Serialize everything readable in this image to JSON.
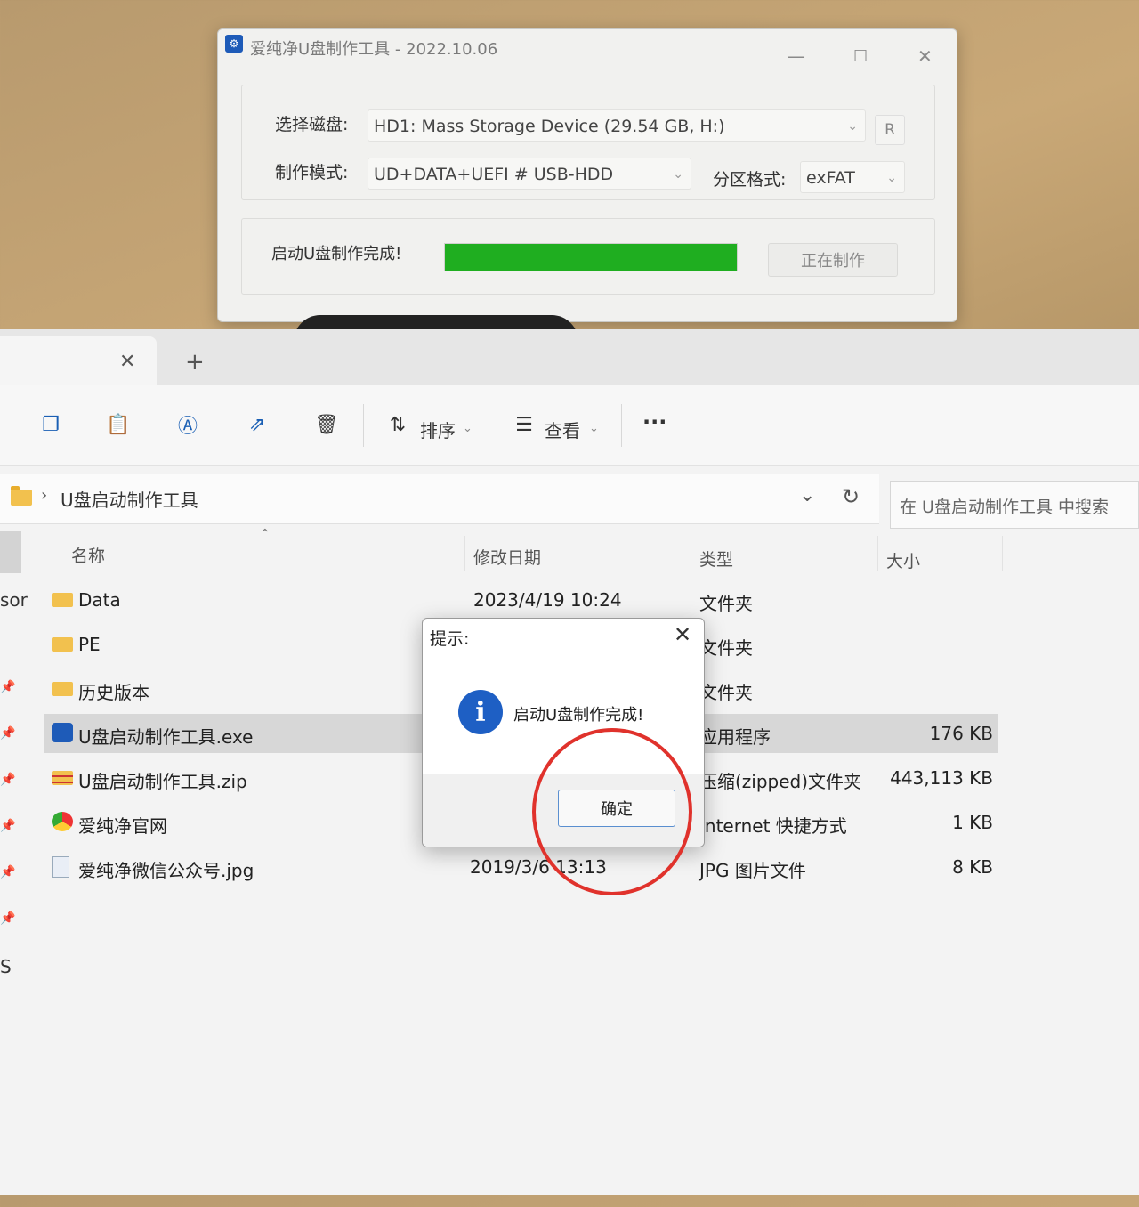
{
  "tool_window": {
    "title": "爱纯净U盘制作工具 - 2022.10.06",
    "disk_label": "选择磁盘:",
    "disk_value": "HD1: Mass Storage Device (29.54 GB, H:)",
    "refresh_label": "R",
    "mode_label": "制作模式:",
    "mode_value": "UD+DATA+UEFI # USB-HDD",
    "partition_label": "分区格式:",
    "partition_value": "exFAT",
    "status_text": "启动U盘制作完成!",
    "progress": 1.0,
    "progress_color": "#1fae20",
    "make_button": "正在制作"
  },
  "explorer": {
    "tab_close": "✕",
    "tab_new": "+",
    "toolbar": {
      "sort_label": "排序",
      "view_label": "查看",
      "more_label": "···"
    },
    "breadcrumb": "U盘启动制作工具",
    "search_placeholder": "在 U盘启动制作工具 中搜索",
    "columns": {
      "name": "名称",
      "date": "修改日期",
      "type": "类型",
      "size": "大小"
    },
    "files": [
      {
        "name": "Data",
        "date": "2023/4/19 10:24",
        "type": "文件夹",
        "size": "",
        "icon": "folder-icon"
      },
      {
        "name": "PE",
        "date": "",
        "type": "文件夹",
        "size": "",
        "icon": "folder-icon"
      },
      {
        "name": "历史版本",
        "date": "",
        "type": "文件夹",
        "size": "",
        "icon": "folder-icon"
      },
      {
        "name": "U盘启动制作工具.exe",
        "date": "",
        "type": "应用程序",
        "size": "176 KB",
        "icon": "exe-icon"
      },
      {
        "name": "U盘启动制作工具.zip",
        "date": "",
        "type": "压缩(zipped)文件夹",
        "size": "443,113 KB",
        "icon": "zip-icon"
      },
      {
        "name": "爱纯净官网",
        "date": "",
        "type": "Internet 快捷方式",
        "size": "1 KB",
        "icon": "browser-shortcut-icon"
      },
      {
        "name": "爱纯净微信公众号.jpg",
        "date": "2019/3/6 13:13",
        "type": "JPG 图片文件",
        "size": "8 KB",
        "icon": "image-file-icon"
      }
    ],
    "left_edge_text_1": "sor",
    "left_edge_text_2": "S"
  },
  "dialog": {
    "title": "提示:",
    "close": "✕",
    "icon": "info-icon",
    "message": "启动U盘制作完成!",
    "ok_button": "确定"
  },
  "annotation": {
    "circle_color": "#e0322c"
  }
}
